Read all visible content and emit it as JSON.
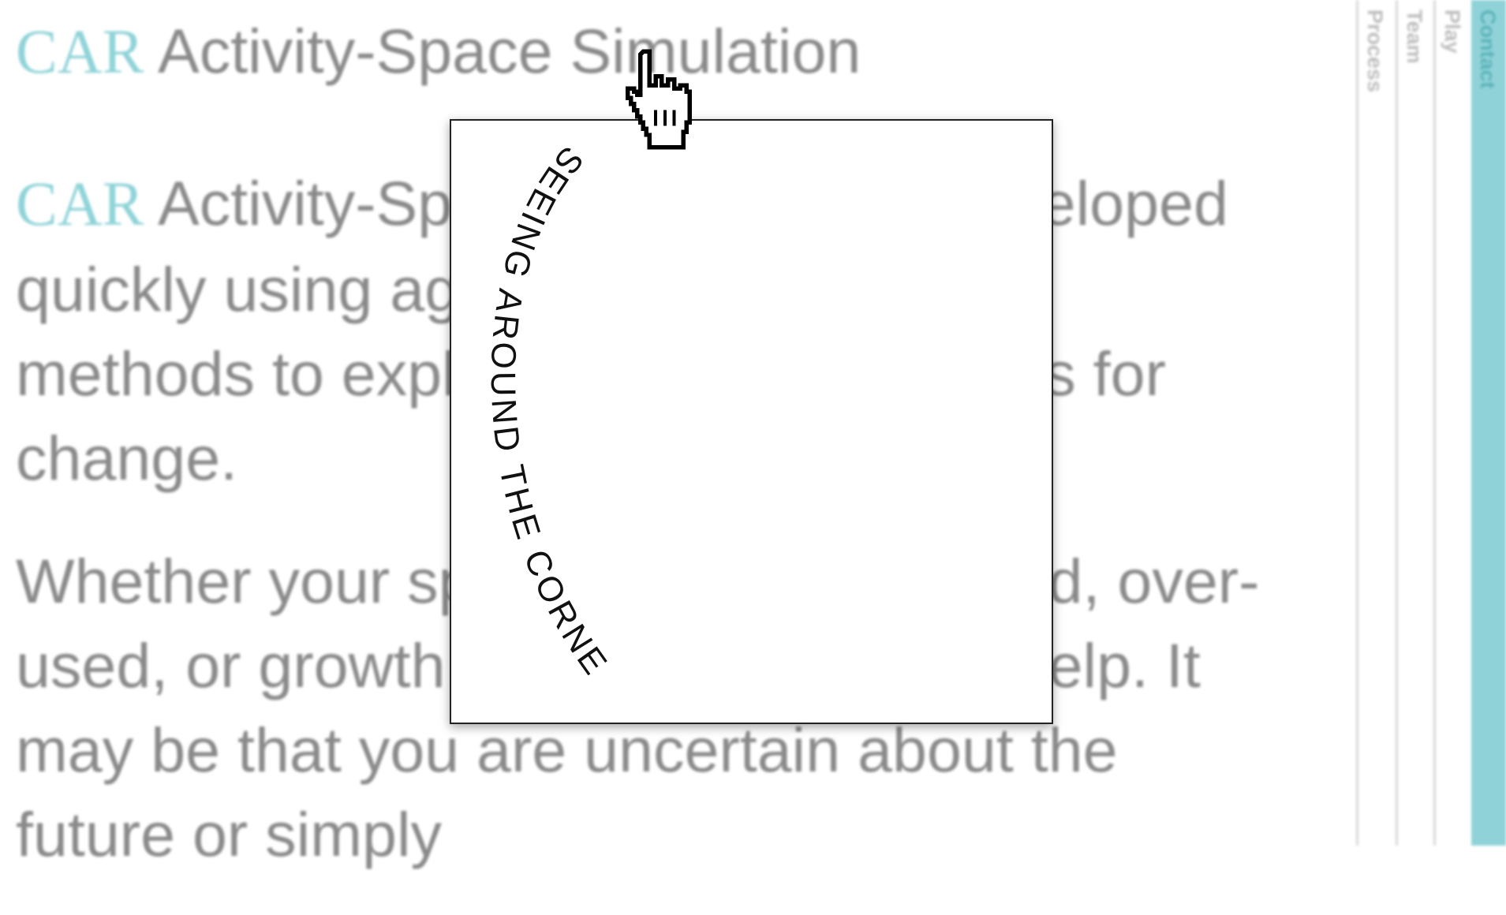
{
  "page": {
    "title_brand": "CAR",
    "title_rest": " Activity-Space Simulation",
    "paragraphs": [
      {
        "brand": "CAR",
        "text": " Activity-Space Simulation is developed quickly using agent-based simulation methods to explore possible scenarios for change."
      },
      {
        "brand": "",
        "text": "Whether your space is under-occupied, over-used, or growth is predicted we can help. It may be that you are uncertain about the future or simply"
      }
    ]
  },
  "side_nav": {
    "items": [
      {
        "label": "Process"
      },
      {
        "label": "Team"
      },
      {
        "label": "Play"
      },
      {
        "label": "Contact",
        "active": true
      }
    ]
  },
  "modal": {
    "arc_text": "SEEING AROUND THE CORNER"
  },
  "colors": {
    "brand_teal": "#8fd3d8",
    "text_grey": "#8a8a8a",
    "accent_bar": "#8fd3d8"
  },
  "icons": {
    "cursor": "hand-pointer-icon"
  }
}
